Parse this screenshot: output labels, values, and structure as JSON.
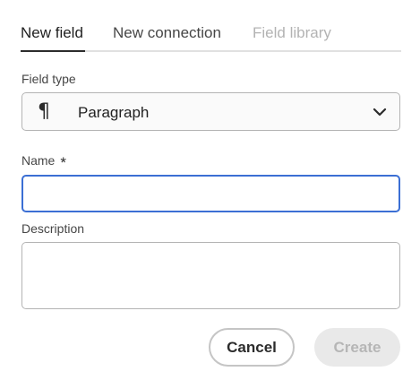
{
  "tabs": [
    {
      "label": "New field",
      "state": "selected"
    },
    {
      "label": "New connection",
      "state": "normal"
    },
    {
      "label": "Field library",
      "state": "disabled"
    }
  ],
  "field_type": {
    "label": "Field type",
    "icon": "paragraph-icon",
    "icon_glyph": "¶",
    "value": "Paragraph"
  },
  "name": {
    "label": "Name",
    "required_marker": "*",
    "value": ""
  },
  "description": {
    "label": "Description",
    "value": ""
  },
  "actions": {
    "cancel_label": "Cancel",
    "create_label": "Create"
  },
  "colors": {
    "focus_border": "#3b6fd4",
    "disabled_bg": "#e9e9e9",
    "disabled_text": "#b6b6b6"
  }
}
